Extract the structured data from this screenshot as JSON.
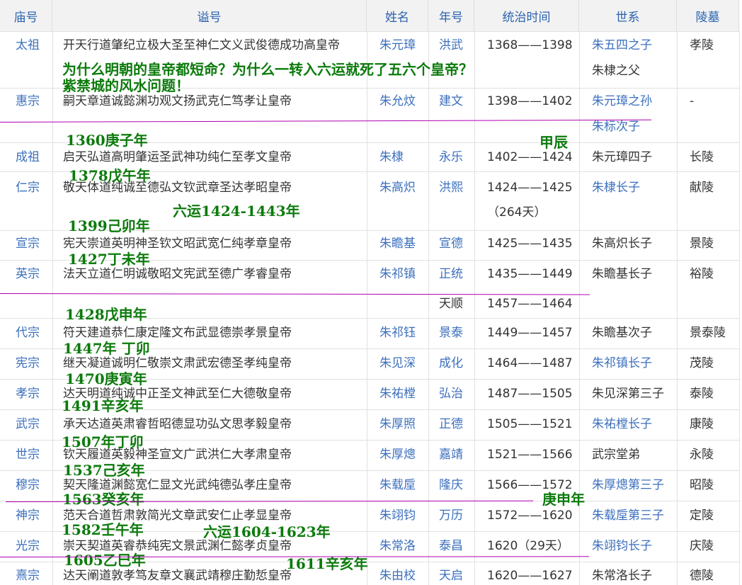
{
  "table": {
    "headers": [
      "庙号",
      "谥号",
      "姓名",
      "年号",
      "统治时间",
      "世系",
      "陵墓"
    ],
    "rows": [
      {
        "temple": "太祖",
        "posthumous": "开天行道肇纪立极大圣至神仁文义武俊德成功高皇帝",
        "name": "朱元璋",
        "era": "洪武",
        "reign": "1368——1398",
        "lineage": [
          "朱五四之子",
          "朱棣之父"
        ],
        "tomb": "孝陵"
      },
      {
        "temple": "惠宗",
        "posthumous": "嗣天章道诚懿渊功观文扬武克仁笃孝让皇帝",
        "name": "朱允炆",
        "era": "建文",
        "reign": "1398——1402",
        "lineage": [
          "朱元璋之孙",
          "朱标次子"
        ],
        "tomb": "-"
      },
      {
        "temple": "成祖",
        "posthumous": "启天弘道高明肇运圣武神功纯仁至孝文皇帝",
        "name": "朱棣",
        "era": "永乐",
        "reign": "1402——1424",
        "lineage": [
          "朱元璋四子"
        ],
        "tomb": "长陵"
      },
      {
        "temple": "仁宗",
        "posthumous": "敬天体道纯诚至德弘文钦武章圣达孝昭皇帝",
        "name": "朱高炽",
        "era": "洪熙",
        "reign": "1424——1425",
        "reign_note": "（264天）",
        "lineage": [
          "朱棣长子"
        ],
        "tomb": "献陵"
      },
      {
        "temple": "宣宗",
        "posthumous": "宪天崇道英明神圣钦文昭武宽仁纯孝章皇帝",
        "name": "朱瞻基",
        "era": "宣德",
        "reign": "1425——1435",
        "lineage": [
          "朱高炽长子"
        ],
        "tomb": "景陵"
      },
      {
        "temple": "英宗",
        "posthumous": "法天立道仁明诚敬昭文宪武至德广孝睿皇帝",
        "name": "朱祁镇",
        "era": "正统",
        "reign": "1435——1449",
        "era2": "天顺",
        "reign2": "1457——1464",
        "lineage": [
          "朱瞻基长子"
        ],
        "tomb": "裕陵"
      },
      {
        "temple": "代宗",
        "posthumous": "符天建道恭仁康定隆文布武显德崇孝景皇帝",
        "name": "朱祁钰",
        "era": "景泰",
        "reign": "1449——1457",
        "lineage": [
          "朱瞻基次子"
        ],
        "tomb": "景泰陵"
      },
      {
        "temple": "宪宗",
        "posthumous": "继天凝道诚明仁敬崇文肃武宏德圣孝纯皇帝",
        "name": "朱见深",
        "era": "成化",
        "reign": "1464——1487",
        "lineage": [
          "朱祁镇长子"
        ],
        "tomb": "茂陵"
      },
      {
        "temple": "孝宗",
        "posthumous": "达天明道纯诚中正圣文神武至仁大德敬皇帝",
        "name": "朱祐樘",
        "era": "弘治",
        "reign": "1487——1505",
        "lineage": [
          "朱见深第三子"
        ],
        "tomb": "泰陵"
      },
      {
        "temple": "武宗",
        "posthumous": "承天达道英肃睿哲昭德显功弘文思孝毅皇帝",
        "name": "朱厚照",
        "era": "正德",
        "reign": "1505——1521",
        "lineage": [
          "朱祐樘长子"
        ],
        "tomb": "康陵"
      },
      {
        "temple": "世宗",
        "posthumous": "钦天履道英毅神圣宣文广武洪仁大孝肃皇帝",
        "name": "朱厚熜",
        "era": "嘉靖",
        "reign": "1521——1566",
        "lineage": [
          "武宗堂弟"
        ],
        "tomb": "永陵"
      },
      {
        "temple": "穆宗",
        "posthumous": "契天隆道渊懿宽仁显文光武纯德弘孝庄皇帝",
        "name": "朱载垕",
        "era": "隆庆",
        "reign": "1566——1572",
        "lineage": [
          "朱厚熜第三子"
        ],
        "tomb": "昭陵"
      },
      {
        "temple": "神宗",
        "posthumous": "范天合道哲肃敦简光文章武安仁止孝显皇帝",
        "name": "朱翊钧",
        "era": "万历",
        "reign": "1572——1620",
        "lineage": [
          "朱载垕第三子"
        ],
        "tomb": "定陵"
      },
      {
        "temple": "光宗",
        "posthumous": "崇天契道英睿恭纯宪文景武渊仁懿孝贞皇帝",
        "name": "朱常洛",
        "era": "泰昌",
        "reign": "1620（29天）",
        "lineage": [
          "朱翊钧长子"
        ],
        "tomb": "庆陵"
      },
      {
        "temple": "熹宗",
        "posthumous": "达天阐道敦孝笃友章文襄武靖穆庄勤悊皇帝",
        "name": "朱由校",
        "era": "天启",
        "reign": "1620——1627",
        "lineage": [
          "朱常洛长子"
        ],
        "tomb": "德陵"
      }
    ]
  },
  "annotations": {
    "title_line1": "为什么明朝的皇帝都短命？为什么一转入六运就死了五六个皇帝？",
    "title_line2": "紫禁城的风水问题！",
    "notes": [
      "1360庚子年",
      "甲辰",
      "1378戊午年",
      "六运1424-1443年",
      "1399己卯年",
      "1427丁未年",
      "1428戊申年",
      "1447年 丁卯",
      "1470庚寅年",
      "1491辛亥年",
      "1507年丁卯",
      "1537己亥年",
      "1563癸亥年",
      "庚申年",
      "1582壬午年",
      "六运1604-1623年",
      "1605乙巳年",
      "1611辛亥年"
    ]
  },
  "colors": {
    "link": "#3b6fbd",
    "text": "#333333",
    "header_bg": "#f2f2f2",
    "annotation": "#0c7a0c",
    "marker_line": "#b000b0"
  }
}
